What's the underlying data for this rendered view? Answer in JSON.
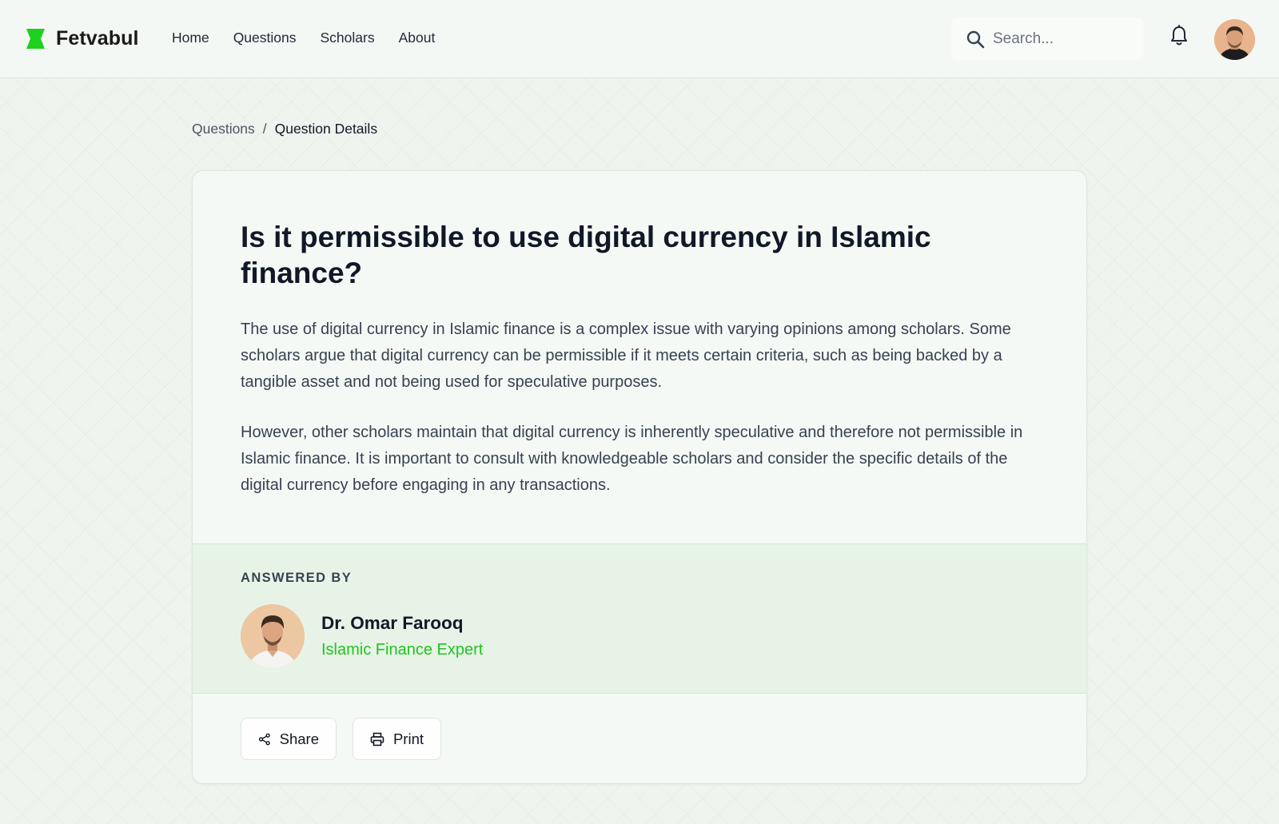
{
  "header": {
    "brand": "Fetvabul",
    "brand_color": "#1ed11e",
    "nav": [
      "Home",
      "Questions",
      "Scholars",
      "About"
    ],
    "search_placeholder": "Search...",
    "icons": {
      "search": "search-icon",
      "notifications": "bell-icon",
      "user": "user-avatar"
    }
  },
  "breadcrumb": {
    "parent": "Questions",
    "separator": "/",
    "current": "Question Details"
  },
  "question": {
    "title": "Is it permissible to use digital currency in Islamic finance?",
    "paragraphs": [
      "The use of digital currency in Islamic finance is a complex issue with varying opinions among scholars. Some scholars argue that digital currency can be permissible if it meets certain criteria, such as being backed by a tangible asset and not being used for speculative purposes.",
      "However, other scholars maintain that digital currency is inherently speculative and therefore not permissible in Islamic finance. It is important to consult with knowledgeable scholars and consider the specific details of the digital currency before engaging in any transactions."
    ]
  },
  "answered_by": {
    "label": "ANSWERED BY",
    "name": "Dr. Omar Farooq",
    "title": "Islamic Finance Expert",
    "title_color": "#1cc61c"
  },
  "actions": {
    "share_label": "Share",
    "share_icon": "share-icon",
    "print_label": "Print",
    "print_icon": "printer-icon"
  }
}
